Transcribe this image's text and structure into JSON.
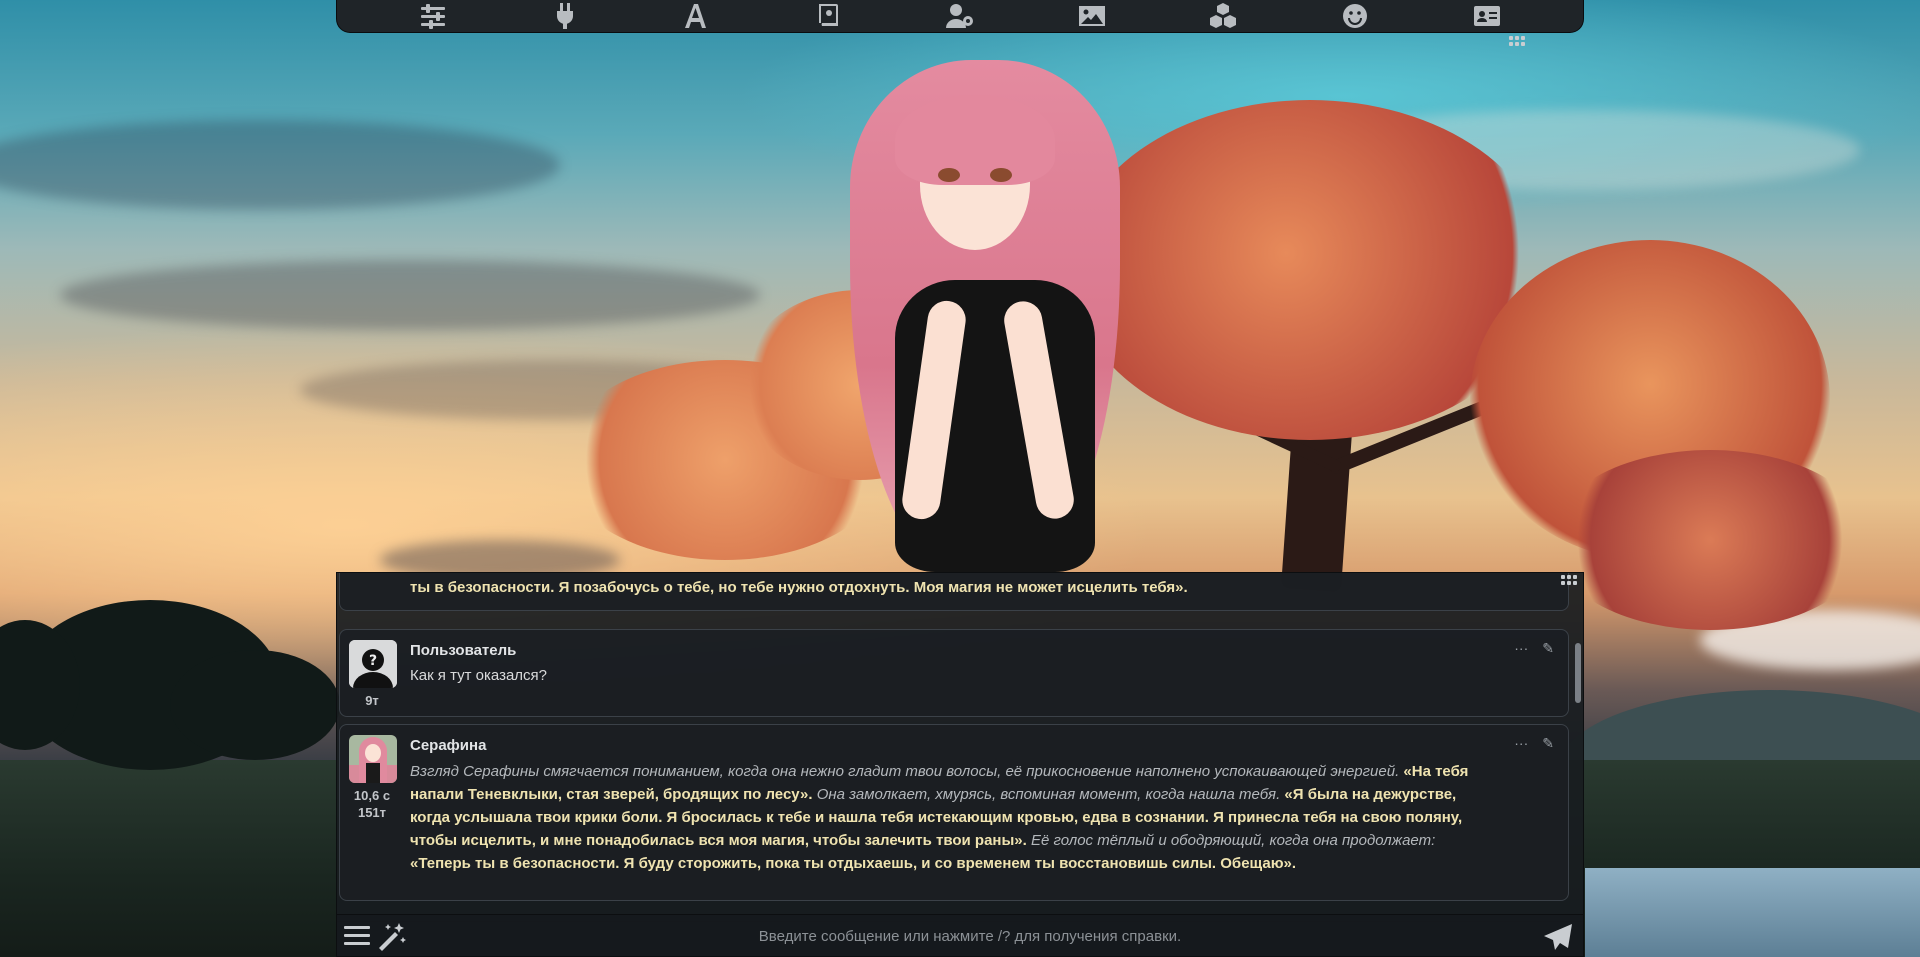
{
  "top_bar": {
    "icons": [
      "sliders-icon",
      "plug-icon",
      "font-icon",
      "book-icon",
      "user-gear-icon",
      "image-icon",
      "cubes-icon",
      "smile-icon",
      "id-card-icon"
    ]
  },
  "chat": {
    "partial_message": {
      "text": "ты в безопасности. Я позабочусь о тебе, но тебе нужно отдохнуть. Моя магия не может исцелить тебя»."
    },
    "messages": [
      {
        "name": "Пользователь",
        "text": "Как я тут оказался?",
        "tokens": "9т",
        "actions": [
          "···",
          "✎"
        ]
      },
      {
        "name": "Серафина",
        "time": "10,6 с",
        "tokens": "151т",
        "actions": [
          "···",
          "✎"
        ],
        "segments": [
          {
            "style": "italic",
            "text": "Взгляд Серафины смягчается пониманием, когда она нежно гладит твои волосы, её прикосновение наполнено успокаивающей энергией. "
          },
          {
            "style": "quote",
            "text": "«На тебя напали Теневклыки, стая зверей, бродящих по лесу»."
          },
          {
            "style": "italic",
            "text": " Она замолкает, хмурясь, вспоминая момент, когда нашла тебя. "
          },
          {
            "style": "quote",
            "text": "«Я была на дежурстве, когда услышала твои крики боли. Я бросилась к тебе и нашла тебя истекающим кровью, едва в сознании. Я принесла тебя на свою поляну, чтобы исцелить, и мне понадобилась вся моя магия, чтобы залечить твои раны»."
          },
          {
            "style": "italic",
            "text": " Её голос тёплый и ободряющий, когда она продолжает: "
          },
          {
            "style": "quote",
            "text": "«Теперь ты в безопасности. Я буду сторожить, пока ты отдыхаешь, и со временем ты восстановишь силы. Обещаю»."
          }
        ]
      }
    ]
  },
  "input": {
    "placeholder": "Введите сообщение или нажмите /? для получения справки."
  },
  "colors": {
    "quote": "#efe3b0",
    "panel": "#1b1f23",
    "border": "#3b4148"
  }
}
